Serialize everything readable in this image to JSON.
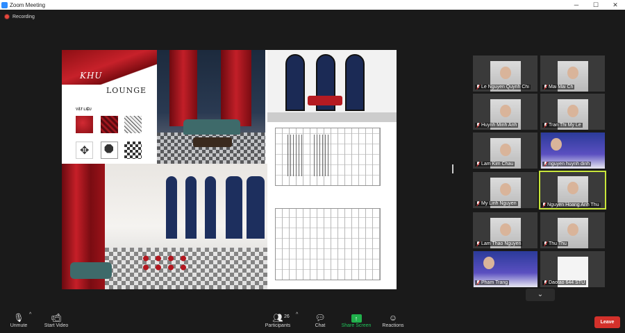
{
  "window": {
    "title": "Zoom Meeting",
    "minimize": "─",
    "maximize": "☐",
    "close": "✕"
  },
  "recording": {
    "label": "Recording"
  },
  "shared_content": {
    "khu_text": "KHU",
    "lounge_text": "LOUNGE",
    "materials_label": "VẬT LIỆU"
  },
  "gallery": {
    "participants": [
      {
        "name": "Le Nguyen Quynh Chi",
        "muted": true
      },
      {
        "name": "Mai Mai Ch",
        "muted": true
      },
      {
        "name": "Huynh Minh Anh",
        "muted": true
      },
      {
        "name": "Tran Thi My Le",
        "muted": true
      },
      {
        "name": "Lam Kim Chau",
        "muted": true
      },
      {
        "name": "nguyen huynh dinh",
        "muted": true
      },
      {
        "name": "My Linh Nguyen",
        "muted": true
      },
      {
        "name": "Nguyen Hoang Anh Thu",
        "muted": true,
        "active_speaker": true
      },
      {
        "name": "Lam Thao Nguyen",
        "muted": true
      },
      {
        "name": "Thu Thu",
        "muted": true
      },
      {
        "name": "Pham Trang",
        "muted": true
      },
      {
        "name": "Daotao 644 STU",
        "muted": true
      }
    ],
    "scroll_icon": "⌄"
  },
  "toolbar": {
    "unmute": "Unmute",
    "start_video": "Start Video",
    "participants": "Participants",
    "participants_count": "26",
    "chat": "Chat",
    "share_screen": "Share Screen",
    "reactions": "Reactions",
    "leave": "Leave",
    "caret": "^"
  },
  "colors": {
    "accent_green": "#21b14c",
    "leave_red": "#d3312b",
    "active_outline": "#c9e63a"
  }
}
